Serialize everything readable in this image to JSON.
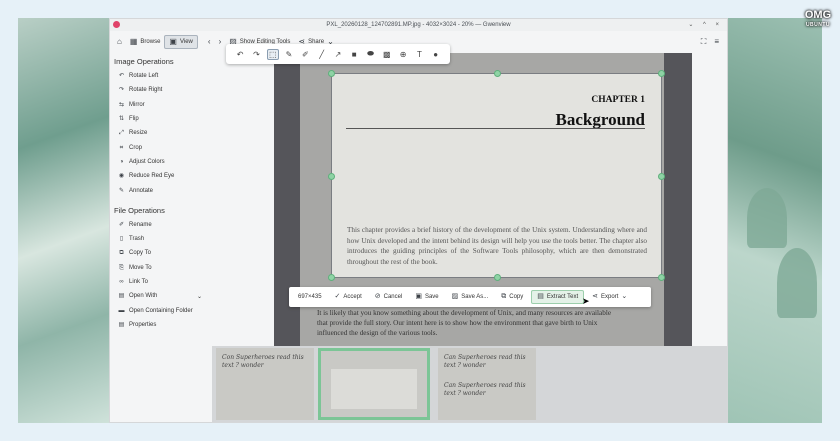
{
  "window": {
    "title": "PXL_20260128_124702891.MP.jpg - 4032×3024 - 20% — Gwenview",
    "controls": "⌄ ^ ×"
  },
  "branding": {
    "logo_line1": "OMG",
    "logo_line2": "UBUNTU"
  },
  "toolbar": {
    "browse": "Browse",
    "view": "View",
    "show_editing_tools": "Show Editing Tools",
    "share": "Share"
  },
  "sidebar": {
    "image_ops_title": "Image Operations",
    "image_ops": [
      "Rotate Left",
      "Rotate Right",
      "Mirror",
      "Flip",
      "Resize",
      "Crop",
      "Adjust Colors",
      "Reduce Red Eye",
      "Annotate"
    ],
    "file_ops_title": "File Operations",
    "file_ops": [
      "Rename",
      "Trash",
      "Copy To",
      "Move To",
      "Link To",
      "Open With",
      "Open Containing Folder",
      "Properties"
    ]
  },
  "document": {
    "chapter": "CHAPTER 1",
    "title": "Background",
    "paragraph": "This chapter provides a brief history of the development of the Unix system. Understanding where and how Unix developed and the intent behind its design will help you use the tools better. The chapter also introduces the guiding principles of the Software Tools philosophy, which are then demonstrated throughout the rest of the book.",
    "lower_text": "It is likely that you know something about the development of Unix, and many resources are available that provide the full story. Our intent here is to show how the environment that gave birth to Unix influenced the design of the various tools."
  },
  "action_bar": {
    "size": "697×435",
    "accept": "Accept",
    "cancel": "Cancel",
    "save": "Save",
    "save_as": "Save As...",
    "copy": "Copy",
    "extract_text": "Extract Text",
    "export": "Export"
  },
  "thumbnails": {
    "t1": "Con Superheroes read this text ? wonder",
    "t3_a": "Can Superheroes read this text ? wonder",
    "t3_b": "Can Superheroes read this text ? wonder"
  }
}
